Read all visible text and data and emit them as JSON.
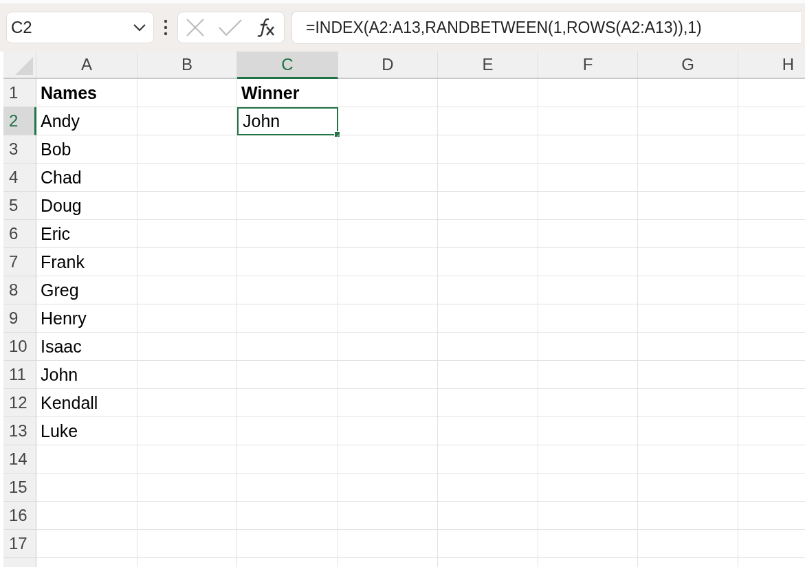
{
  "name_box": {
    "value": "C2"
  },
  "formula_bar": {
    "value": "=INDEX(A2:A13,RANDBETWEEN(1,ROWS(A2:A13)),1)"
  },
  "columns": [
    {
      "label": "A",
      "selected": false
    },
    {
      "label": "B",
      "selected": false
    },
    {
      "label": "C",
      "selected": true
    },
    {
      "label": "D",
      "selected": false
    },
    {
      "label": "E",
      "selected": false
    },
    {
      "label": "F",
      "selected": false
    },
    {
      "label": "G",
      "selected": false
    },
    {
      "label": "H",
      "selected": false
    }
  ],
  "rows": [
    {
      "label": "1",
      "selected": false,
      "cells": [
        {
          "text": "Names",
          "bold": true,
          "selected": false
        },
        {},
        {
          "text": "Winner",
          "bold": true,
          "selected": false
        }
      ]
    },
    {
      "label": "2",
      "selected": true,
      "cells": [
        {
          "text": "Andy",
          "bold": false,
          "selected": false
        },
        {},
        {
          "text": "John",
          "bold": false,
          "selected": true
        }
      ]
    },
    {
      "label": "3",
      "selected": false,
      "cells": [
        {
          "text": "Bob",
          "bold": false,
          "selected": false
        }
      ]
    },
    {
      "label": "4",
      "selected": false,
      "cells": [
        {
          "text": "Chad",
          "bold": false,
          "selected": false
        }
      ]
    },
    {
      "label": "5",
      "selected": false,
      "cells": [
        {
          "text": "Doug",
          "bold": false,
          "selected": false
        }
      ]
    },
    {
      "label": "6",
      "selected": false,
      "cells": [
        {
          "text": "Eric",
          "bold": false,
          "selected": false
        }
      ]
    },
    {
      "label": "7",
      "selected": false,
      "cells": [
        {
          "text": "Frank",
          "bold": false,
          "selected": false
        }
      ]
    },
    {
      "label": "8",
      "selected": false,
      "cells": [
        {
          "text": "Greg",
          "bold": false,
          "selected": false
        }
      ]
    },
    {
      "label": "9",
      "selected": false,
      "cells": [
        {
          "text": "Henry",
          "bold": false,
          "selected": false
        }
      ]
    },
    {
      "label": "10",
      "selected": false,
      "cells": [
        {
          "text": "Isaac",
          "bold": false,
          "selected": false
        }
      ]
    },
    {
      "label": "11",
      "selected": false,
      "cells": [
        {
          "text": "John",
          "bold": false,
          "selected": false
        }
      ]
    },
    {
      "label": "12",
      "selected": false,
      "cells": [
        {
          "text": "Kendall",
          "bold": false,
          "selected": false
        }
      ]
    },
    {
      "label": "13",
      "selected": false,
      "cells": [
        {
          "text": "Luke",
          "bold": false,
          "selected": false
        }
      ]
    },
    {
      "label": "14",
      "selected": false,
      "cells": []
    },
    {
      "label": "15",
      "selected": false,
      "cells": []
    },
    {
      "label": "16",
      "selected": false,
      "cells": []
    },
    {
      "label": "17",
      "selected": false,
      "cells": []
    }
  ]
}
